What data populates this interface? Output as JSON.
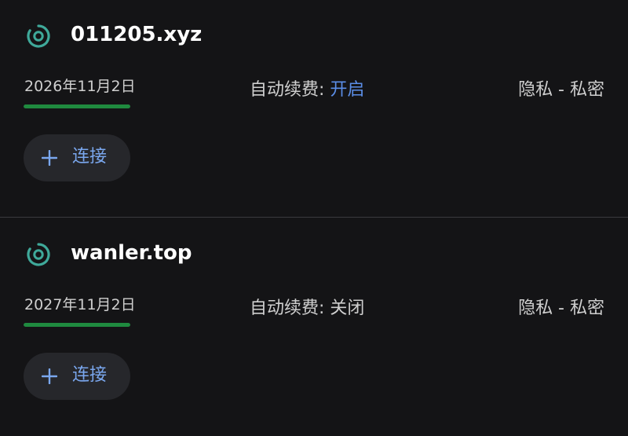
{
  "domains": [
    {
      "name": "011205.xyz",
      "icon": "domain-target-icon",
      "expiry_date": "2026年11月2日",
      "expiry_progress": 1.0,
      "autorenew_label": "自动续费: ",
      "autorenew_value": "开启",
      "privacy": "隐私 - 私密",
      "connect_label": "连接"
    },
    {
      "name": "wanler.top",
      "icon": "domain-target-icon",
      "expiry_date": "2027年11月2日",
      "expiry_progress": 1.0,
      "autorenew_label": "自动续费: ",
      "autorenew_value": "关闭",
      "privacy": "隐私 - 私密",
      "connect_label": "连接"
    }
  ],
  "colors": {
    "accent_blue": "#5b8ee8",
    "progress_green": "#1f8a3f",
    "icon_teal": "#3fa99a",
    "background": "#141416"
  }
}
